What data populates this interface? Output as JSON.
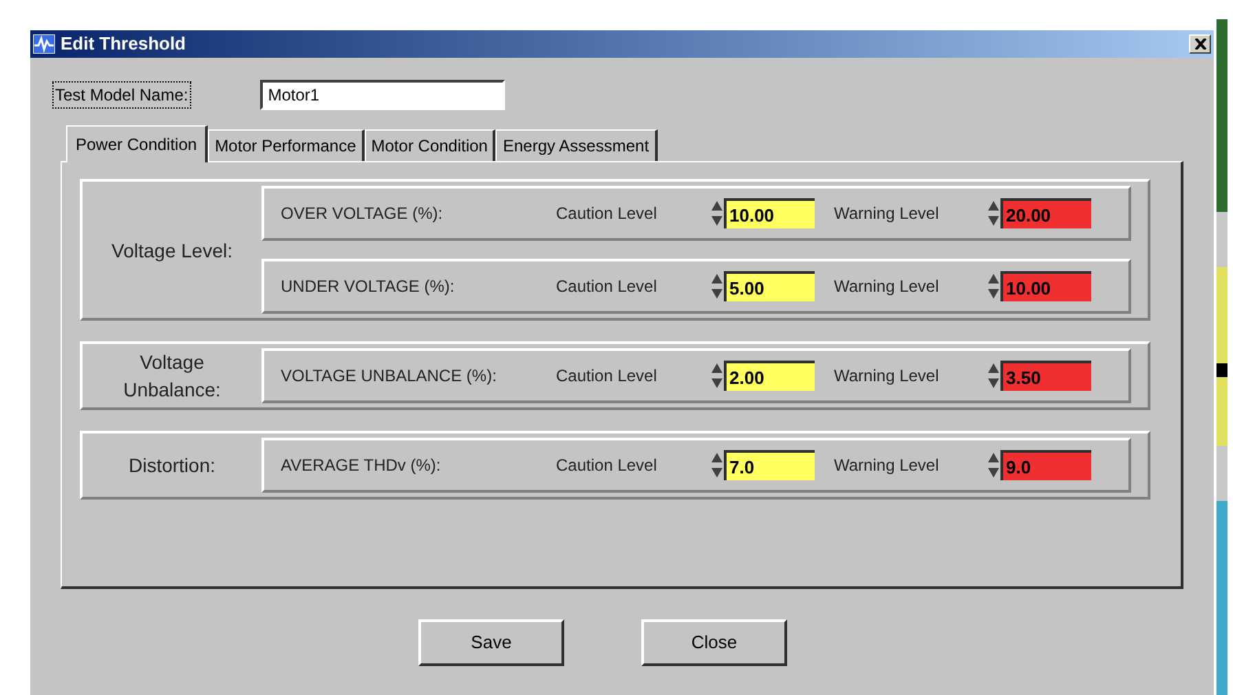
{
  "window": {
    "title": "Edit Threshold"
  },
  "model_name": {
    "label": "Test Model Name:",
    "value": "Motor1"
  },
  "tabs": [
    {
      "label": "Power Condition",
      "selected": true
    },
    {
      "label": "Motor Performance",
      "selected": false
    },
    {
      "label": "Motor Condition",
      "selected": false
    },
    {
      "label": "Energy Assessment",
      "selected": false
    }
  ],
  "groups": [
    {
      "label": "Voltage Level:",
      "rows": [
        {
          "name": "OVER VOLTAGE (%):",
          "caution_label": "Caution Level",
          "caution": "10.00",
          "warning_label": "Warning Level",
          "warning": "20.00"
        },
        {
          "name": "UNDER VOLTAGE (%):",
          "caution_label": "Caution Level",
          "caution": "5.00",
          "warning_label": "Warning Level",
          "warning": "10.00"
        }
      ]
    },
    {
      "label": "Voltage Unbalance:",
      "rows": [
        {
          "name": "VOLTAGE UNBALANCE (%):",
          "caution_label": "Caution Level",
          "caution": "2.00",
          "warning_label": "Warning Level",
          "warning": "3.50"
        }
      ]
    },
    {
      "label": "Distortion:",
      "rows": [
        {
          "name": "AVERAGE THDv (%):",
          "caution_label": "Caution Level",
          "caution": "7.0",
          "warning_label": "Warning Level",
          "warning": "9.0"
        }
      ]
    }
  ],
  "buttons": [
    "Save",
    "Close"
  ]
}
